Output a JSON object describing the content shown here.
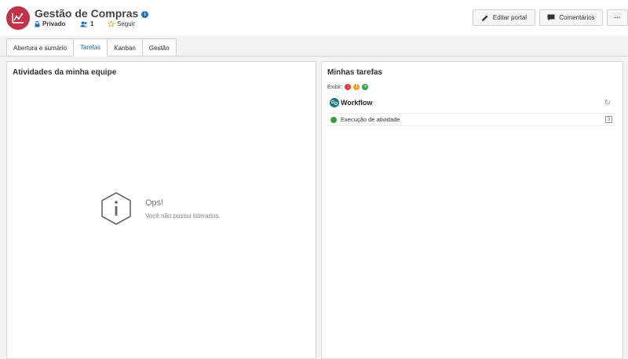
{
  "header": {
    "title": "Gestão de Compras",
    "visibility": "Privado",
    "members": "1",
    "follow": "Seguir",
    "edit_portal": "Editar portal",
    "comments": "Comentários",
    "more": "···",
    "brand_color": "#c0334a"
  },
  "tabs": [
    {
      "label": "Abertura e sumário",
      "active": false
    },
    {
      "label": "Tarefas",
      "active": true
    },
    {
      "label": "Kanban",
      "active": false
    },
    {
      "label": "Gestão",
      "active": false
    }
  ],
  "team_panel": {
    "title": "Atividades da minha equipe",
    "empty_title": "Ops!",
    "empty_message": "Você não possui liderados."
  },
  "tasks_panel": {
    "title": "Minhas tarefas",
    "filter_label": "Exibir:",
    "filters": [
      {
        "icon": "arrow-down-icon",
        "color": "#e03a3a"
      },
      {
        "icon": "exclamation-icon",
        "color": "#f0a020"
      },
      {
        "icon": "plus-icon",
        "color": "#3aa04a"
      }
    ],
    "group_label": "Workflow",
    "task_label": "Execução de atividade",
    "task_count": "3"
  }
}
